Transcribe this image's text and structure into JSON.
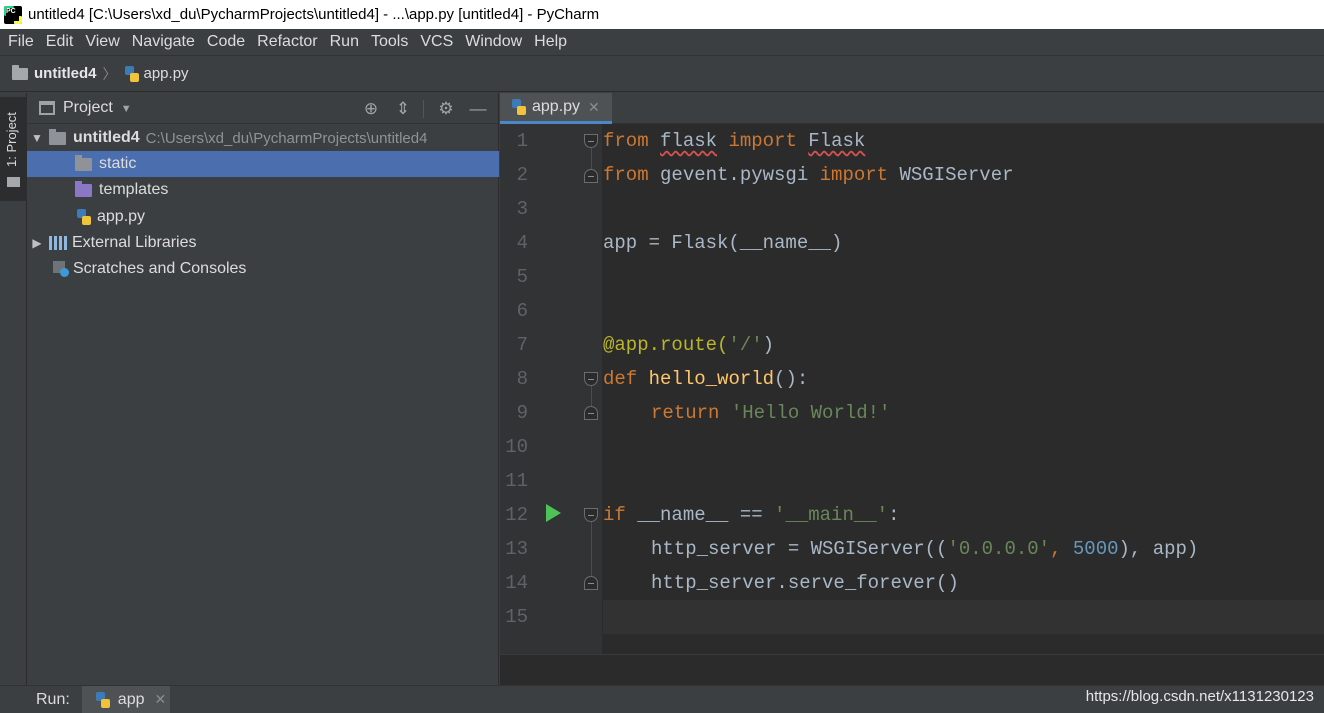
{
  "window": {
    "title": "untitled4 [C:\\Users\\xd_du\\PycharmProjects\\untitled4] - ...\\app.py [untitled4] - PyCharm",
    "app_logo_text": "PC"
  },
  "menu": [
    "File",
    "Edit",
    "View",
    "Navigate",
    "Code",
    "Refactor",
    "Run",
    "Tools",
    "VCS",
    "Window",
    "Help"
  ],
  "navbar": {
    "project": "untitled4",
    "separator": "〉",
    "file": "app.py"
  },
  "tool_strip": {
    "project_tab": "1: Project"
  },
  "project_panel": {
    "title": "Project",
    "tools": [
      "locate-icon",
      "collapse-icon",
      "gear-icon",
      "minimize-icon"
    ],
    "tree": [
      {
        "label": "untitled4",
        "path": "C:\\Users\\xd_du\\PycharmProjects\\untitled4",
        "icon": "folder-icon",
        "expanded": true
      },
      {
        "label": "static",
        "icon": "folder-icon",
        "selected": true
      },
      {
        "label": "templates",
        "icon": "templates-folder-icon"
      },
      {
        "label": "app.py",
        "icon": "python-file-icon"
      },
      {
        "label": "External Libraries",
        "icon": "libraries-icon",
        "expanded": false
      },
      {
        "label": "Scratches and Consoles",
        "icon": "scratches-icon"
      }
    ]
  },
  "editor": {
    "tab": {
      "label": "app.py",
      "close": "✕"
    },
    "line_numbers": [
      "1",
      "2",
      "3",
      "4",
      "5",
      "6",
      "7",
      "8",
      "9",
      "10",
      "11",
      "12",
      "13",
      "14",
      "15"
    ],
    "current_line": 15,
    "run_gutter_line": 12
  },
  "code": {
    "l1": {
      "kw1": "from",
      "mod": "flask",
      "kw2": "import",
      "name": "Flask"
    },
    "l2": {
      "kw1": "from",
      "mod": "gevent.pywsgi",
      "kw2": "import",
      "name": "WSGIServer"
    },
    "l4": {
      "text": "app = Flask(__name__)"
    },
    "l7": {
      "dec": "@app.route(",
      "str": "'/'",
      "close": ")"
    },
    "l8": {
      "kw": "def",
      "fn": "hello_world",
      "rest": "():"
    },
    "l9": {
      "kw": "return",
      "str": "'Hello World!'"
    },
    "l12": {
      "kw": "if",
      "mid": "__name__ == ",
      "str": "'__main__'",
      "rest": ":"
    },
    "l13": {
      "pre": "http_server = WSGIServer((",
      "str": "'0.0.0.0'",
      "comma": ", ",
      "num": "5000",
      "rest": "), app)"
    },
    "l14": {
      "text": "http_server.serve_forever()"
    }
  },
  "run_bar": {
    "label": "Run:",
    "tab": "app",
    "close": "✕"
  },
  "watermark": "https://blog.csdn.net/x1131230123",
  "colors": {
    "keyword": "#cc7832",
    "string": "#6a8759",
    "number": "#6897bb",
    "function": "#ffc66d",
    "decorator": "#bbb529",
    "selection": "#4b6eaf",
    "run_icon": "#4fc257"
  }
}
